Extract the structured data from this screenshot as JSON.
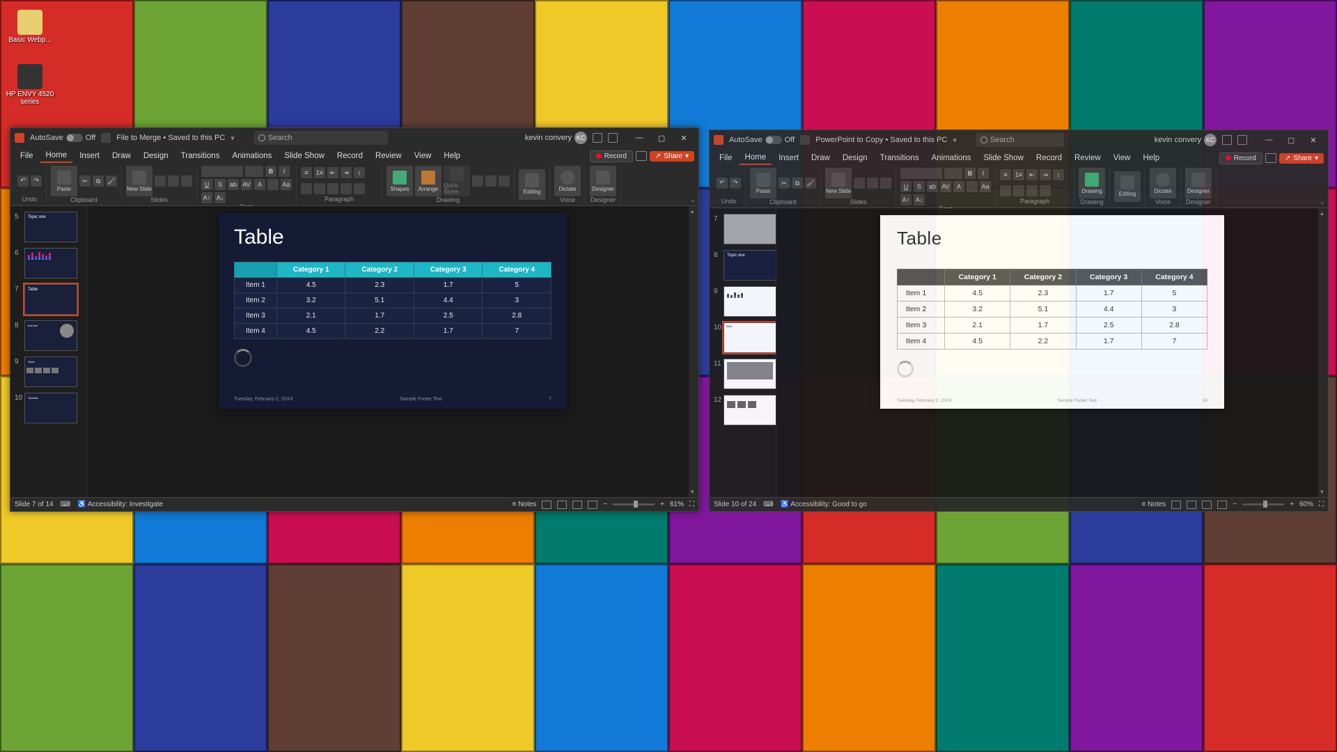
{
  "desktop": {
    "icons": [
      {
        "label": "Basic Webp..."
      },
      {
        "label": "HP ENVY 4520 series"
      }
    ]
  },
  "windows": [
    {
      "id": "left",
      "focused": true,
      "autosave_label": "AutoSave",
      "autosave_state": "Off",
      "title": "File to Merge • Saved to this PC",
      "search_placeholder": "Search",
      "user_name": "kevin convery",
      "user_initials": "KC",
      "menus": [
        "File",
        "Home",
        "Insert",
        "Draw",
        "Design",
        "Transitions",
        "Animations",
        "Slide Show",
        "Record",
        "Review",
        "View",
        "Help"
      ],
      "active_menu": "Home",
      "record_label": "Record",
      "share_label": "Share",
      "ribbon_groups": [
        "Undo",
        "Clipboard",
        "Slides",
        "Font",
        "Paragraph",
        "Drawing",
        "Voice",
        "Designer"
      ],
      "ribbon_big": {
        "paste": "Paste",
        "new_slide": "New Slide",
        "shapes": "Shapes",
        "arrange": "Arrange",
        "quick": "Quick Styles",
        "editing": "Editing",
        "dictate": "Dictate",
        "designer": "Designer"
      },
      "thumbs_start": 5,
      "thumbs_count": 6,
      "selected_thumb": 7,
      "slide": {
        "title": "Table",
        "headers": [
          "",
          "Category 1",
          "Category 2",
          "Category 3",
          "Category 4"
        ],
        "rows": [
          [
            "Item 1",
            "4.5",
            "2.3",
            "1.7",
            "5"
          ],
          [
            "Item 2",
            "3.2",
            "5.1",
            "4.4",
            "3"
          ],
          [
            "Item 3",
            "2.1",
            "1.7",
            "2.5",
            "2.8"
          ],
          [
            "Item 4",
            "4.5",
            "2.2",
            "1.7",
            "7"
          ]
        ],
        "footer_date": "Tuesday, February 2, 20XX",
        "footer_text": "Sample Footer Text",
        "footer_page": "7"
      },
      "status": {
        "slide": "Slide 7 of 14",
        "accessibility": "Accessibility: Investigate",
        "notes": "Notes",
        "zoom": "61%"
      },
      "chart_data": {
        "type": "table",
        "title": "Table",
        "columns": [
          "Item",
          "Category 1",
          "Category 2",
          "Category 3",
          "Category 4"
        ],
        "data": [
          {
            "Item": "Item 1",
            "Category 1": 4.5,
            "Category 2": 2.3,
            "Category 3": 1.7,
            "Category 4": 5
          },
          {
            "Item": "Item 2",
            "Category 1": 3.2,
            "Category 2": 5.1,
            "Category 3": 4.4,
            "Category 4": 3
          },
          {
            "Item": "Item 3",
            "Category 1": 2.1,
            "Category 2": 1.7,
            "Category 3": 2.5,
            "Category 4": 2.8
          },
          {
            "Item": "Item 4",
            "Category 1": 4.5,
            "Category 2": 2.2,
            "Category 3": 1.7,
            "Category 4": 7
          }
        ]
      }
    },
    {
      "id": "right",
      "focused": false,
      "autosave_label": "AutoSave",
      "autosave_state": "Off",
      "title": "PowerPoint to Copy • Saved to this PC",
      "search_placeholder": "Search",
      "user_name": "kevin convery",
      "user_initials": "KC",
      "menus": [
        "File",
        "Home",
        "Insert",
        "Draw",
        "Design",
        "Transitions",
        "Animations",
        "Slide Show",
        "Record",
        "Review",
        "View",
        "Help"
      ],
      "active_menu": "Home",
      "record_label": "Record",
      "share_label": "Share",
      "ribbon_groups": [
        "Undo",
        "Clipboard",
        "Slides",
        "Font",
        "Paragraph",
        "Drawing",
        "Voice",
        "Designer"
      ],
      "ribbon_big": {
        "paste": "Paste",
        "new_slide": "New Slide",
        "drawing": "Drawing",
        "editing": "Editing",
        "dictate": "Dictate",
        "designer": "Designer"
      },
      "thumbs_start": 7,
      "thumbs_count": 6,
      "selected_thumb": 10,
      "slide": {
        "title": "Table",
        "headers": [
          "",
          "Category 1",
          "Category 2",
          "Category 3",
          "Category 4"
        ],
        "rows": [
          [
            "Item 1",
            "4.5",
            "2.3",
            "1.7",
            "5"
          ],
          [
            "Item 2",
            "3.2",
            "5.1",
            "4.4",
            "3"
          ],
          [
            "Item 3",
            "2.1",
            "1.7",
            "2.5",
            "2.8"
          ],
          [
            "Item 4",
            "4.5",
            "2.2",
            "1.7",
            "7"
          ]
        ],
        "footer_date": "Tuesday, February 2, 20XX",
        "footer_text": "Sample Footer Text",
        "footer_page": "10"
      },
      "status": {
        "slide": "Slide 10 of 24",
        "accessibility": "Accessibility: Good to go",
        "notes": "Notes",
        "zoom": "60%"
      },
      "chart_data": {
        "type": "table",
        "title": "Table",
        "columns": [
          "Item",
          "Category 1",
          "Category 2",
          "Category 3",
          "Category 4"
        ],
        "data": [
          {
            "Item": "Item 1",
            "Category 1": 4.5,
            "Category 2": 2.3,
            "Category 3": 1.7,
            "Category 4": 5
          },
          {
            "Item": "Item 2",
            "Category 1": 3.2,
            "Category 2": 5.1,
            "Category 3": 4.4,
            "Category 4": 3
          },
          {
            "Item": "Item 3",
            "Category 1": 2.1,
            "Category 2": 1.7,
            "Category 3": 2.5,
            "Category 4": 2.8
          },
          {
            "Item": "Item 4",
            "Category 1": 4.5,
            "Category 2": 2.2,
            "Category 3": 1.7,
            "Category 4": 7
          }
        ]
      }
    }
  ]
}
